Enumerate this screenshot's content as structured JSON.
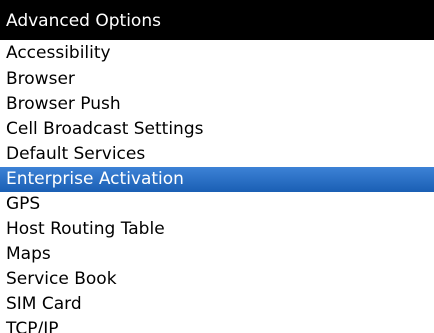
{
  "title": "Advanced Options",
  "menu": {
    "selected_index": 6,
    "items": [
      "Accessibility",
      "Browser",
      "Browser Push",
      "Cell Broadcast Settings",
      "Default Services",
      "Enterprise Activation",
      "GPS",
      "Host Routing Table",
      "Maps",
      "Service Book",
      "SIM Card",
      "TCP/IP"
    ]
  },
  "colors": {
    "title_bar": "#000000",
    "title_text": "#ffffff",
    "selection": "#1f64bc",
    "background": "#ffffff"
  }
}
